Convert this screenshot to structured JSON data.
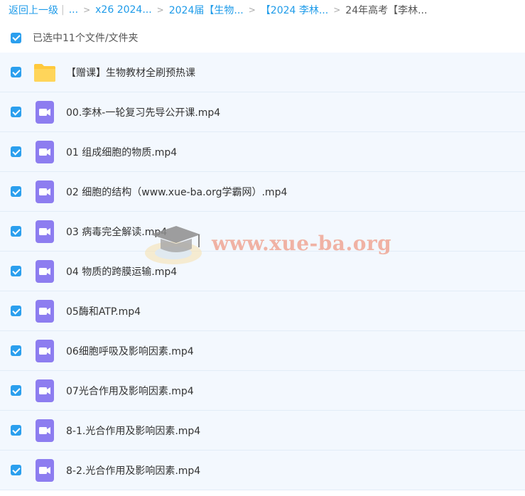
{
  "breadcrumb": {
    "back": "返回上一级",
    "ellipsis": "...",
    "crumbs": [
      "x26 2024...",
      "2024届【生物...",
      "【2024 李林...",
      "24年高考【李林..."
    ]
  },
  "selection": {
    "summary": "已选中11个文件/文件夹"
  },
  "files": [
    {
      "name": "【赠课】生物教材全刷预热课",
      "icon": "folder-icon"
    },
    {
      "name": "00.李林-一轮复习先导公开课.mp4",
      "icon": "video-icon"
    },
    {
      "name": "01 组成细胞的物质.mp4",
      "icon": "video-icon"
    },
    {
      "name": "02 细胞的结构（www.xue-ba.org学霸网）.mp4",
      "icon": "video-icon"
    },
    {
      "name": "03 病毒完全解读.mp4",
      "icon": "video-icon"
    },
    {
      "name": "04 物质的跨膜运输.mp4",
      "icon": "video-icon"
    },
    {
      "name": "05酶和ATP.mp4",
      "icon": "video-icon"
    },
    {
      "name": "06细胞呼吸及影响因素.mp4",
      "icon": "video-icon"
    },
    {
      "name": "07光合作用及影响因素.mp4",
      "icon": "video-icon"
    },
    {
      "name": "8-1.光合作用及影响因素.mp4",
      "icon": "video-icon"
    },
    {
      "name": "8-2.光合作用及影响因素.mp4",
      "icon": "video-icon"
    }
  ],
  "watermark": {
    "text": "www.xue-ba.org"
  },
  "colors": {
    "link": "#1e9be9",
    "checkbox": "#2b9fee",
    "row_background": "#f3f8fe",
    "folder": "#ffc93c",
    "video": "#8d7df0"
  }
}
